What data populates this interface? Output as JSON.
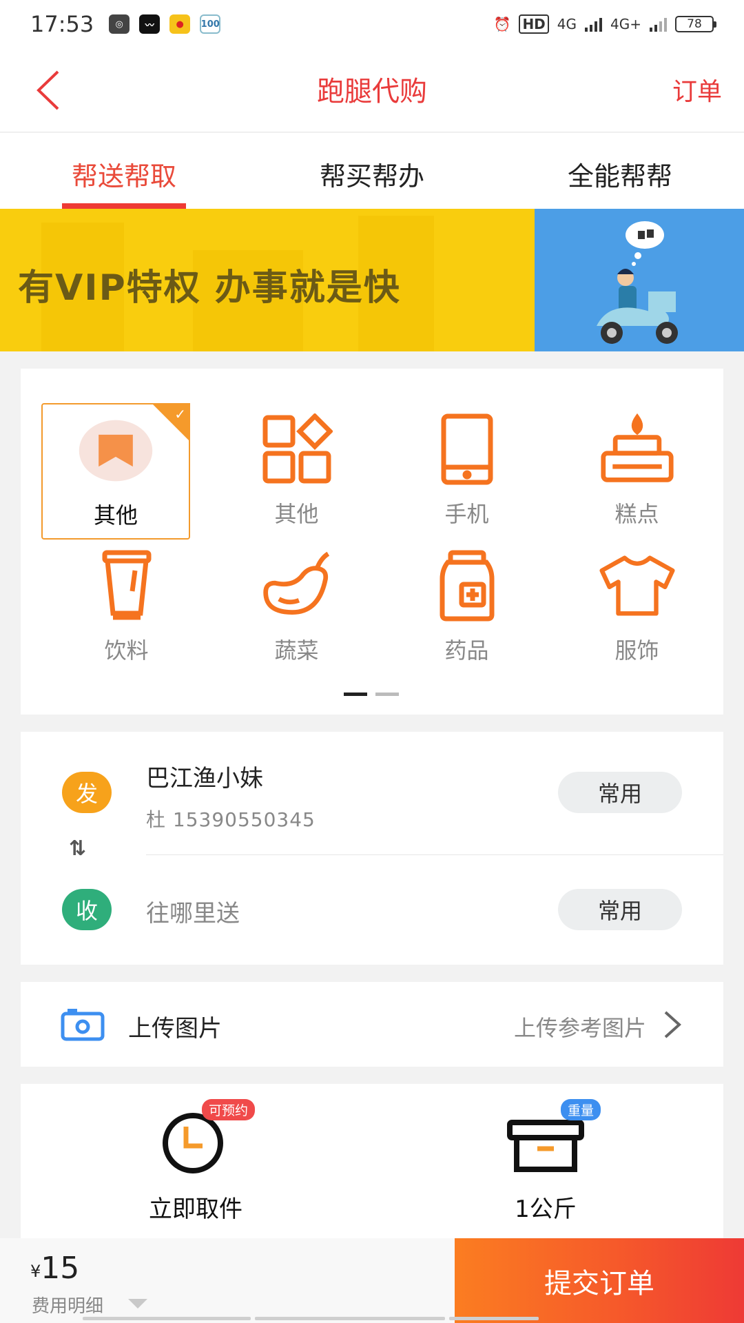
{
  "status_bar": {
    "time": "17:53",
    "app_icons": [
      "chat-bubble-icon",
      "bird-icon",
      "weibo-icon",
      "app-100-icon"
    ],
    "app_100_label": "100",
    "network_hd": "HD",
    "network_4g_1": "4G",
    "network_4g_2": "4G+",
    "battery": "78"
  },
  "header": {
    "title": "跑腿代购",
    "right_action": "订单",
    "back_icon": "back-arrow-icon"
  },
  "tabs": [
    {
      "label": "帮送帮取",
      "active": true
    },
    {
      "label": "帮买帮办",
      "active": false
    },
    {
      "label": "全能帮帮",
      "active": false
    }
  ],
  "banner": {
    "text": "有VIP特权  办事就是快",
    "background": "#f9cd0e",
    "right_background": "#4c9ee6"
  },
  "categories": {
    "page_count": 2,
    "active_page": 1,
    "items": [
      {
        "label": "其他",
        "icon": "bookmark-icon",
        "selected": true
      },
      {
        "label": "其他",
        "icon": "grid-apps-icon",
        "selected": false
      },
      {
        "label": "手机",
        "icon": "phone-icon",
        "selected": false
      },
      {
        "label": "糕点",
        "icon": "cake-icon",
        "selected": false
      },
      {
        "label": "饮料",
        "icon": "drink-cup-icon",
        "selected": false
      },
      {
        "label": "蔬菜",
        "icon": "eggplant-icon",
        "selected": false
      },
      {
        "label": "药品",
        "icon": "medicine-bottle-icon",
        "selected": false
      },
      {
        "label": "服饰",
        "icon": "tshirt-icon",
        "selected": false
      }
    ]
  },
  "address": {
    "send_badge": "发",
    "sender_name": "巴江渔小妹",
    "sender_contact": "杜   15390550345",
    "swap_icon": "swap-arrows-icon",
    "recv_badge": "收",
    "recv_placeholder": "往哪里送",
    "frequent_label": "常用"
  },
  "upload": {
    "label": "上传图片",
    "hint": "上传参考图片",
    "icon": "camera-icon"
  },
  "options": [
    {
      "label": "立即取件",
      "tag": "可预约",
      "icon": "clock-icon"
    },
    {
      "label": "1公斤",
      "tag": "重量",
      "icon": "box-icon"
    }
  ],
  "bottom": {
    "currency": "¥",
    "price": "15",
    "fee_detail": "费用明细",
    "submit": "提交订单"
  },
  "colors": {
    "accent_red": "#e93b3b",
    "accent_orange": "#f5731f",
    "send_badge": "#f7a21b",
    "recv_badge": "#2fae7b"
  }
}
